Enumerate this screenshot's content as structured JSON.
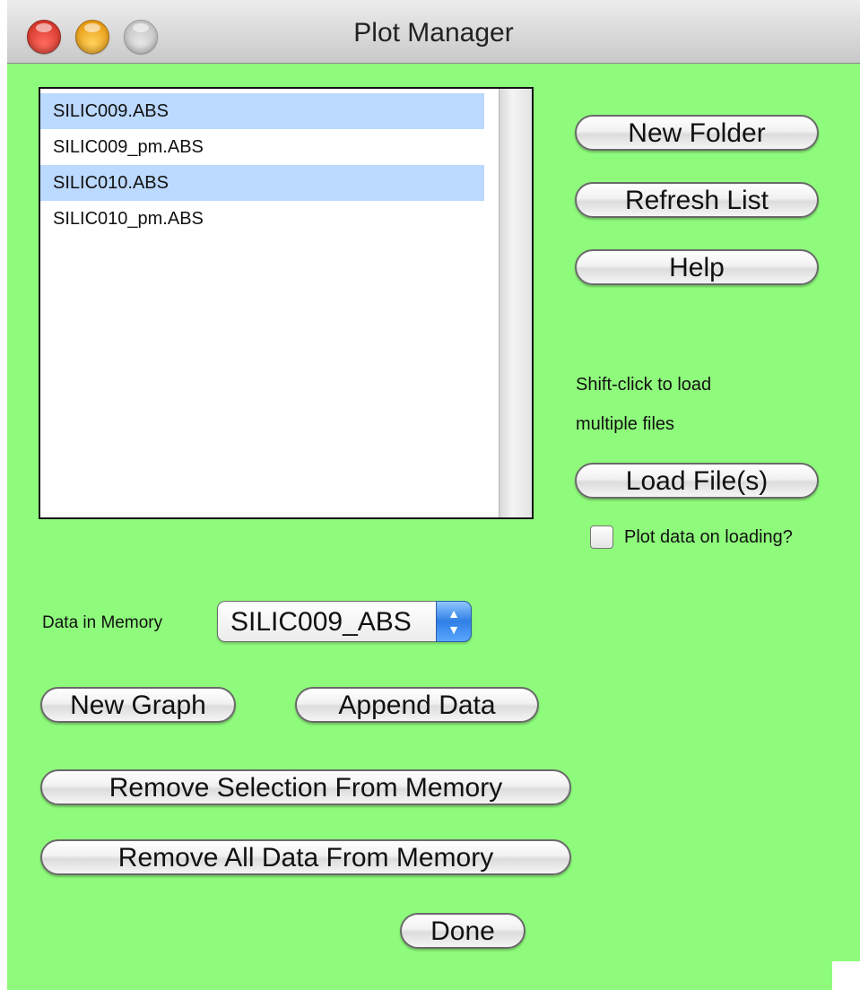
{
  "window": {
    "title": "Plot Manager"
  },
  "files": [
    {
      "name": "SILIC009.ABS",
      "selected": true
    },
    {
      "name": "SILIC009_pm.ABS",
      "selected": false
    },
    {
      "name": "SILIC010.ABS",
      "selected": true
    },
    {
      "name": "SILIC010_pm.ABS",
      "selected": false
    }
  ],
  "buttons": {
    "new_folder": "New Folder",
    "refresh_list": "Refresh List",
    "help": "Help",
    "load_files": "Load File(s)",
    "new_graph": "New Graph",
    "append_data": "Append Data",
    "remove_selection": "Remove Selection From Memory",
    "remove_all": "Remove All Data From Memory",
    "done": "Done"
  },
  "hint": {
    "line1": "Shift-click to load",
    "line2": "multiple files"
  },
  "plot_on_loading": {
    "label": "Plot data on loading?",
    "checked": false
  },
  "memory": {
    "label": "Data in Memory",
    "selected": "SILIC009_ABS"
  },
  "colors": {
    "background": "#8ffb7c",
    "selection": "#bcd9ff"
  },
  "icons": {
    "popup_arrows": "up-down-arrows-icon"
  }
}
